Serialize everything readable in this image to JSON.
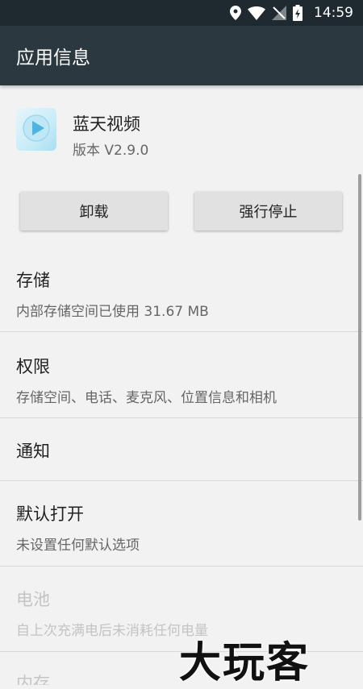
{
  "status_bar": {
    "time": "14:59",
    "icons": [
      "location-icon",
      "wifi-icon",
      "no-sim-icon",
      "battery-charging-icon"
    ]
  },
  "app_bar": {
    "title": "应用信息"
  },
  "app": {
    "name": "蓝天视频",
    "version": "版本 V2.9.0",
    "icon": "play-icon"
  },
  "buttons": {
    "uninstall": "卸载",
    "force_stop": "强行停止"
  },
  "sections": {
    "storage": {
      "title": "存储",
      "summary": "内部存储空间已使用 31.67 MB"
    },
    "permissions": {
      "title": "权限",
      "summary": "存储空间、电话、麦克风、位置信息和相机"
    },
    "notifications": {
      "title": "通知"
    },
    "open_by_default": {
      "title": "默认打开",
      "summary": "未设置任何默认选项"
    },
    "battery": {
      "title": "电池",
      "summary": "自上次充满电后未消耗任何电量"
    },
    "memory": {
      "title": "内存"
    }
  },
  "watermark": "大玩客",
  "colors": {
    "status_bar": "#1f2a30",
    "app_bar": "#2b383f",
    "background": "#f2f2f2",
    "button": "#e1e1e1"
  }
}
